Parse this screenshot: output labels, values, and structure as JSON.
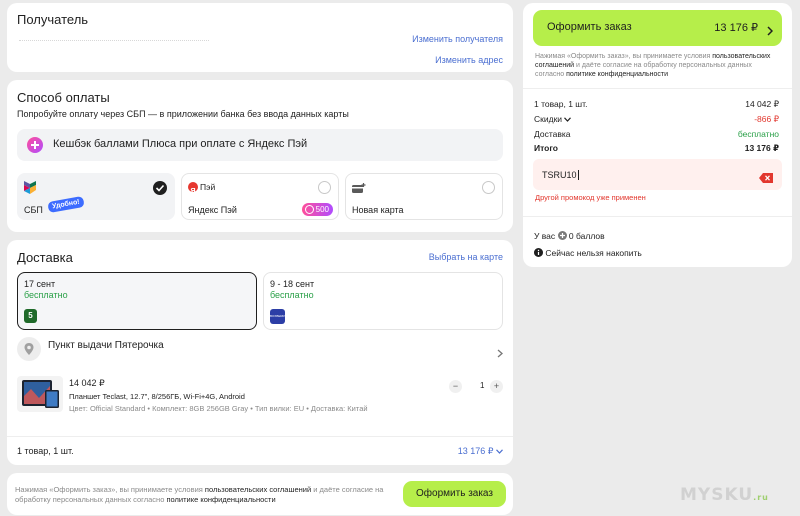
{
  "recipient": {
    "title": "Получатель",
    "change_recipient": "Изменить получателя",
    "change_address": "Изменить адрес"
  },
  "payment": {
    "title": "Способ оплаты",
    "subtitle": "Попробуйте оплату через СБП — в приложении банка без ввода данных карты",
    "cashback": "Кешбэк баллами Плюса при оплате с Яндекс Пэй",
    "options": [
      {
        "name": "СБП",
        "badge": "Удобно!",
        "selected": true
      },
      {
        "logo_text": "Пэй",
        "name": "Яндекс Пэй",
        "badge": "500",
        "selected": false
      },
      {
        "name": "Новая карта",
        "selected": false
      }
    ]
  },
  "delivery": {
    "title": "Доставка",
    "map_link": "Выбрать на карте",
    "options": [
      {
        "date": "17 сент",
        "price": "бесплатно",
        "logo": "5",
        "selected": true
      },
      {
        "date": "9 - 18 сент",
        "price": "бесплатно",
        "logo": "BOXBERRY",
        "selected": false
      }
    ],
    "pickup": "Пункт выдачи Пятерочка",
    "product": {
      "price": "14 042 ₽",
      "name": "Планшет Teclast, 12.7\", 8/256ГБ, Wi-Fi+4G, Android",
      "specs": "Цвет: Official Standard • Комплект: 8GB 256GB Gray • Тип вилки: EU • Доставка: Китай",
      "qty": "1",
      "minus": "−",
      "plus": "+"
    },
    "footer_count": "1 товар, 1 шт.",
    "footer_total": "13 176 ₽"
  },
  "bottom": {
    "consent_1": "Нажимая «Оформить заказ», вы принимаете условия",
    "consent_link_1": "пользовательских соглашений",
    "consent_2": "и даёте согласие на",
    "consent_3": "обработку персональных данных согласно",
    "consent_link_2": "политике конфиденциальности",
    "button": "Оформить заказ"
  },
  "summary": {
    "button_label": "Оформить заказ",
    "button_total": "13 176 ₽",
    "consent_1": "Нажимая «Оформить заказ», вы принимаете условия",
    "consent_link_1": "пользовательских",
    "consent_link_2": "соглашений",
    "consent_2": "и даёте согласие на обработку персональных данных",
    "consent_3": "согласно",
    "consent_link_3": "политике конфиденциальности",
    "rows": [
      {
        "label": "1 товар, 1 шт.",
        "value": "14 042 ₽"
      },
      {
        "label": "Скидки",
        "value": "-866 ₽"
      },
      {
        "label": "Доставка",
        "value": "бесплатно"
      },
      {
        "label": "Итого",
        "value": "13 176 ₽"
      }
    ],
    "promo_value": "TSRU10",
    "promo_error": "Другой промокод уже применен",
    "points_prefix": "У вас",
    "points_suffix": "0 баллов",
    "points_note": "Сейчас нельзя накопить"
  },
  "watermark": "MYSKU",
  "watermark_suffix": ".ru"
}
